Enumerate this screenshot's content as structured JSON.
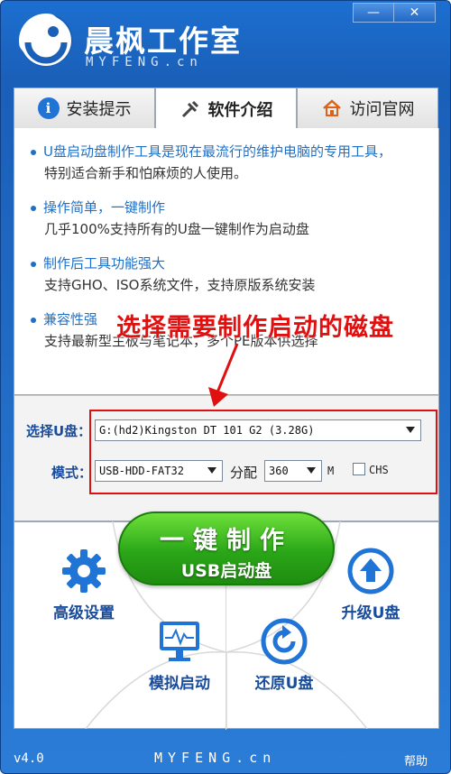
{
  "header": {
    "brand_name": "晨枫工作室",
    "brand_sub": "MYFENG.cn",
    "minimize_glyph": "—",
    "close_glyph": "✕"
  },
  "tabs": [
    {
      "label": "安装提示",
      "icon": "info-icon"
    },
    {
      "label": "软件介绍",
      "icon": "tools-icon"
    },
    {
      "label": "访问官网",
      "icon": "home-icon"
    }
  ],
  "features": [
    {
      "head": "U盘启动盘制作工具是现在最流行的维护电脑的专用工具，",
      "body": "特别适合新手和怕麻烦的人使用。"
    },
    {
      "head": "操作简单，一键制作",
      "body": "几乎100%支持所有的U盘一键制作为启动盘"
    },
    {
      "head": "制作后工具功能强大",
      "body": "支持GHO、ISO系统文件，支持原版系统安装"
    },
    {
      "head": "兼容性强",
      "body": "支持最新型主板与笔记本，多个PE版本供选择"
    }
  ],
  "annotation": "选择需要制作启动的磁盘",
  "settings": {
    "disk_label": "选择U盘：",
    "disk_value": "G:(hd2)Kingston DT 101 G2 (3.28G)",
    "mode_label": "模式：",
    "mode_value": "USB-HDD-FAT32",
    "alloc_label": "分配",
    "alloc_value": "360",
    "alloc_unit": "M",
    "chs_label": "CHS"
  },
  "actions": {
    "make_line1": "一键制作",
    "make_line2": "USB启动盘",
    "advanced": "高级设置",
    "upgrade": "升级U盘",
    "simulate": "模拟启动",
    "restore": "还原U盘"
  },
  "footer": {
    "version": "v4.0",
    "site": "MYFENG.cn",
    "help": "帮助"
  },
  "colors": {
    "frame_blue": "#1a5fb8",
    "accent_green": "#2aa618",
    "annotation_red": "#e01010",
    "label_blue": "#1a4c9c"
  }
}
